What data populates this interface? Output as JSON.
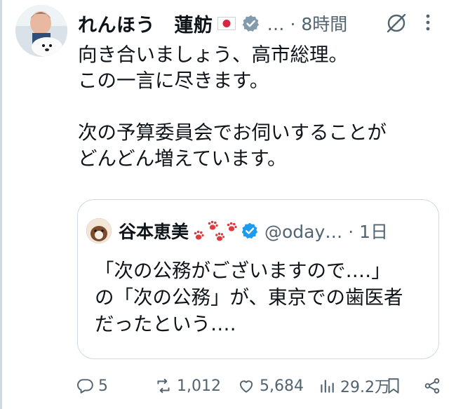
{
  "post": {
    "author_name": "れんほう　蓮舫",
    "meta": "… · 8時間",
    "text_lines": [
      "向き合いましょう、高市総理。",
      "この一言に尽きます。",
      "",
      "次の予算委員会でお伺いすることが",
      "どんどん増えています。"
    ]
  },
  "quote": {
    "author_name": "谷本恵美",
    "handle_time": "@oday… · 1日",
    "text_lines": [
      "「次の公務がございますので‥‥」",
      "の「次の公務」が、東京での歯医者",
      "だったという‥‥"
    ]
  },
  "actions": {
    "replies": "5",
    "reposts": "1,012",
    "likes": "5,684",
    "views": "29.2万"
  },
  "icons": [
    "verified-badge-icon",
    "japan-flag-icon",
    "grok-icon",
    "more-icon",
    "paw-print-icon",
    "reply-icon",
    "repost-icon",
    "like-icon",
    "views-icon",
    "bookmark-icon",
    "share-icon"
  ],
  "colors": {
    "text": "#0f1419",
    "secondary": "#536471",
    "verified": "#1d9bf0",
    "border": "#cfd9de"
  }
}
